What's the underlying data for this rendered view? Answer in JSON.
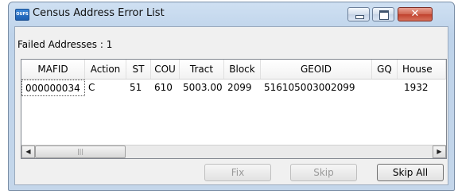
{
  "window": {
    "app_icon_text": "OUPS",
    "title": "Census Address Error List",
    "close_glyph": "✕"
  },
  "failed_label": "Failed Addresses : 1",
  "grid": {
    "columns": [
      "MAFID",
      "Action",
      "ST",
      "COU",
      "Tract",
      "Block",
      "GEOID",
      "GQ",
      "House"
    ],
    "rows": [
      [
        "000000034",
        "C",
        "51",
        "610",
        "5003.00",
        "2099",
        "516105003002099",
        "",
        "1932"
      ]
    ]
  },
  "scrollbar": {
    "left_arrow": "◀",
    "right_arrow": "▶",
    "thumb_grip": "|||"
  },
  "buttons": {
    "fix": "Fix",
    "skip": "Skip",
    "skip_all": "Skip All"
  }
}
